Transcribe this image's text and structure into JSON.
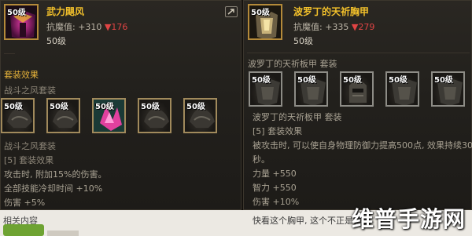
{
  "left": {
    "item": {
      "level": "50级",
      "name": "武力飓风",
      "stat_label": "抗魔值: +310",
      "stat_delta": "▼176",
      "level_text": "50级"
    },
    "set_title": "套装效果",
    "set_name": "战斗之风套装",
    "set_pieces": [
      {
        "level": "50级",
        "icon": "armor-piece-icon"
      },
      {
        "level": "50级",
        "icon": "armor-piece-icon"
      },
      {
        "level": "50级",
        "icon": "crystal-armor-icon"
      },
      {
        "level": "50级",
        "icon": "armor-piece-icon"
      },
      {
        "level": "50级",
        "icon": "armor-piece-icon"
      }
    ],
    "set_name_2": "战斗之风套装",
    "bonus_title": "[5] 套装效果",
    "bonus_lines": [
      "攻击时, 附加15%的伤害。",
      "全部技能冷却时间 +10%",
      "伤害 +5%"
    ]
  },
  "right": {
    "item": {
      "level": "50级",
      "name": "波罗丁的天祈胸甲",
      "stat_label": "抗魔值: +335",
      "stat_delta": "▼279",
      "level_text": "50级"
    },
    "set_title": "波罗丁的天祈板甲  套装",
    "set_pieces": [
      {
        "level": "50级",
        "icon": "plate-armor-icon"
      },
      {
        "level": "50级",
        "icon": "plate-armor-icon"
      },
      {
        "level": "50级",
        "icon": "helmet-icon"
      },
      {
        "level": "50级",
        "icon": "plate-armor-icon"
      },
      {
        "level": "50级",
        "icon": "plate-armor-icon"
      }
    ],
    "set_name_2": "波罗丁的天祈板甲  套装",
    "bonus_title": "[5] 套装效果",
    "bonus_lines": [
      "被攻击时, 可以使自身物理防御力提高500点, 效果持续30",
      "秒。",
      "力量 +550",
      "智力 +550",
      "伤害 +10%"
    ]
  },
  "bottom": {
    "related_label": "相关内容",
    "comment": "快看这个胸甲, 这个不正是锤王"
  },
  "watermark": "维普手游网",
  "colors": {
    "gold": "#f2c02b",
    "section": "#e5b23a",
    "down": "#e04444",
    "frame_gold": "#b48a3a"
  }
}
